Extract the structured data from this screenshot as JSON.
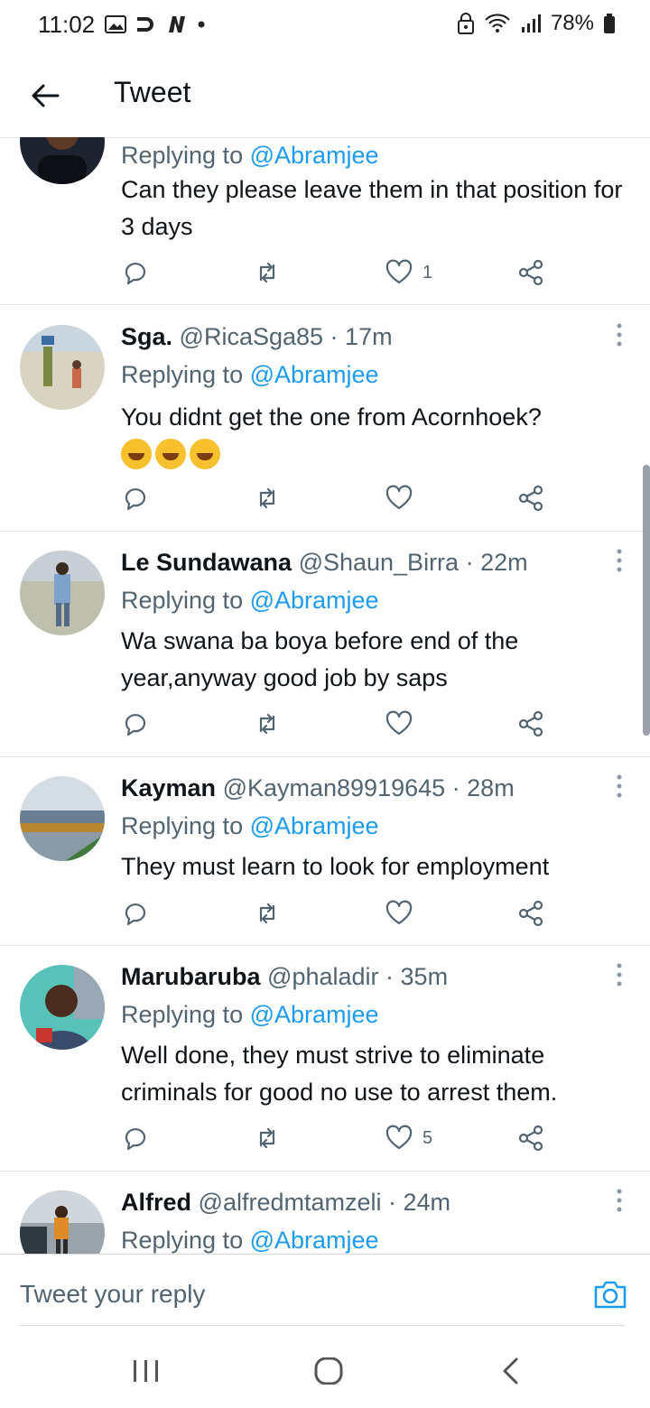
{
  "status": {
    "time": "11:02",
    "battery": "78%"
  },
  "header": {
    "title": "Tweet"
  },
  "tweets": [
    {
      "name": "",
      "handle": "",
      "time": "",
      "replying_label": "Replying to",
      "replying_to": "@Abramjee",
      "text": "Can they please leave them in that position for 3 days",
      "likes": "1"
    },
    {
      "name": "Sga.",
      "handle": "@RicaSga85",
      "time": "17m",
      "replying_label": "Replying to",
      "replying_to": "@Abramjee",
      "text": "You didnt get the one from Acornhoek?",
      "likes": ""
    },
    {
      "name": "Le Sundawana",
      "handle": "@Shaun_Birra",
      "time": "22m",
      "replying_label": "Replying to",
      "replying_to": "@Abramjee",
      "text": "Wa swana ba boya before end of the year,anyway good job by saps",
      "likes": ""
    },
    {
      "name": "Kayman",
      "handle": "@Kayman89919645",
      "time": "28m",
      "replying_label": "Replying to",
      "replying_to": "@Abramjee",
      "text": "They must learn to look for employment",
      "likes": ""
    },
    {
      "name": "Marubaruba",
      "handle": "@phaladir",
      "time": "35m",
      "replying_label": "Replying to",
      "replying_to": "@Abramjee",
      "text": "Well done, they must strive to eliminate criminals for good no use to arrest them.",
      "likes": "5"
    },
    {
      "name": "Alfred",
      "handle": "@alfredmtamzeli",
      "time": "24m",
      "replying_label": "Replying to",
      "replying_to": "@Abramjee",
      "text": "",
      "likes": ""
    }
  ],
  "composer": {
    "placeholder": "Tweet your reply"
  },
  "colors": {
    "link": "#1d9bf0",
    "muted": "#536471",
    "text": "#0f1419"
  }
}
